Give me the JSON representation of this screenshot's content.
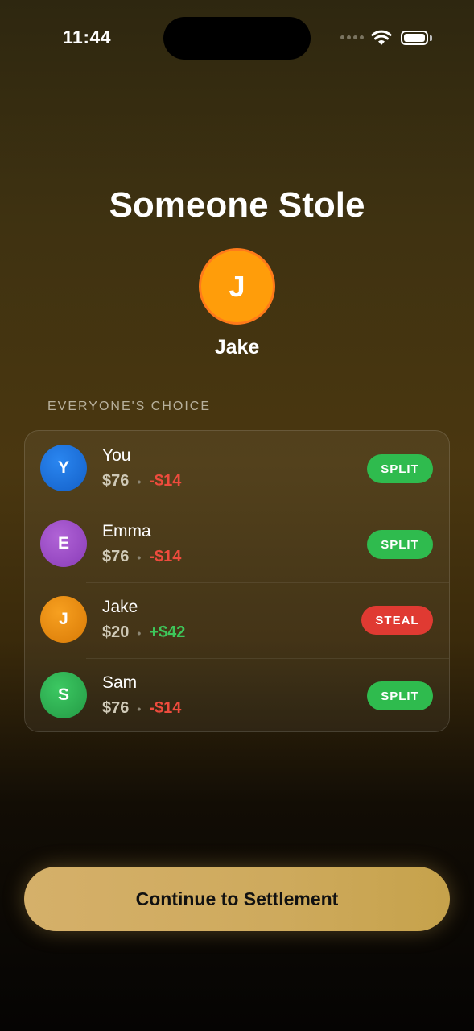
{
  "status_bar": {
    "time": "11:44"
  },
  "header": {
    "title": "Someone Stole"
  },
  "winner": {
    "initial": "J",
    "name": "Jake",
    "avatar_color": "#ff9d0a"
  },
  "section": {
    "label": "EVERYONE'S CHOICE"
  },
  "players": [
    {
      "initial": "Y",
      "name": "You",
      "amount": "$76",
      "delta": "-$14",
      "delta_sign": "negative",
      "choice": "SPLIT",
      "avatar_color": "#1a73e8"
    },
    {
      "initial": "E",
      "name": "Emma",
      "amount": "$76",
      "delta": "-$14",
      "delta_sign": "negative",
      "choice": "SPLIT",
      "avatar_color": "#9b4fc8"
    },
    {
      "initial": "J",
      "name": "Jake",
      "amount": "$20",
      "delta": "+$42",
      "delta_sign": "positive",
      "choice": "STEAL",
      "avatar_color": "#f08c0a"
    },
    {
      "initial": "S",
      "name": "Sam",
      "amount": "$76",
      "delta": "-$14",
      "delta_sign": "negative",
      "choice": "SPLIT",
      "avatar_color": "#2fb552"
    }
  ],
  "actions": {
    "continue_label": "Continue to Settlement"
  },
  "colors": {
    "split": "#2fbb4e",
    "steal": "#e03a32",
    "accent": "#d5b06a"
  }
}
